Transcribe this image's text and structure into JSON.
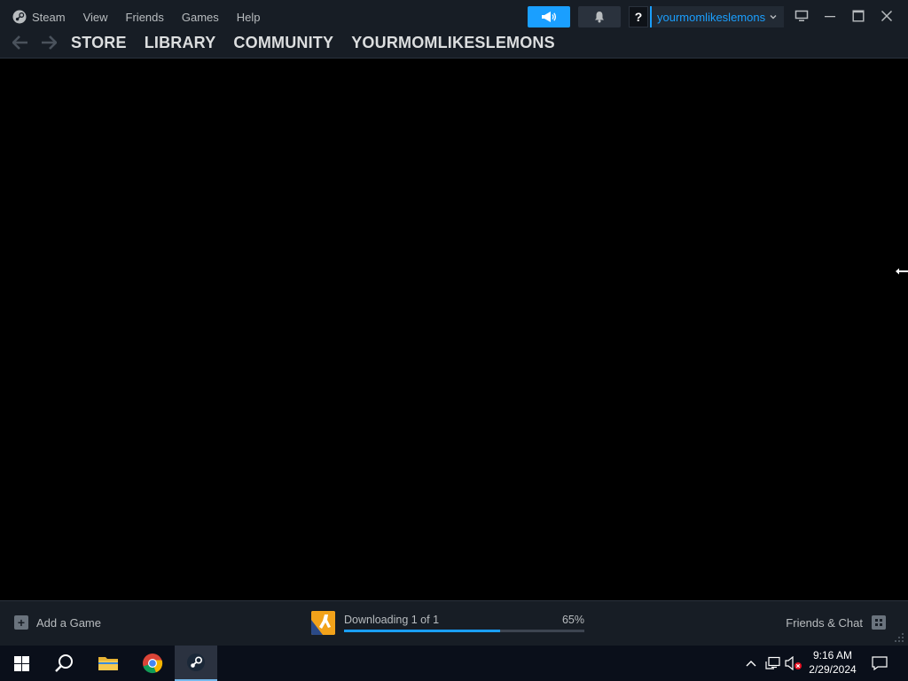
{
  "menu": {
    "steam": "Steam",
    "view": "View",
    "friends": "Friends",
    "games": "Games",
    "help": "Help"
  },
  "nav": {
    "store": "STORE",
    "library": "LIBRARY",
    "community": "COMMUNITY",
    "profile": "YOURMOMLIKESLEMONS"
  },
  "account": {
    "help_label": "?",
    "username": "yourmomlikeslemons"
  },
  "statusbar": {
    "add_game": "Add a Game",
    "download_text": "Downloading 1 of 1",
    "download_percent_label": "65%",
    "download_progress": 0.65,
    "friends_chat": "Friends & Chat"
  },
  "taskbar": {
    "time": "9:16 AM",
    "date": "2/29/2024"
  },
  "colors": {
    "accent": "#1a9fff",
    "titlebar_bg": "#171d25",
    "content_bg": "#000000",
    "taskbar_bg": "#0a0f1a"
  },
  "icons": {
    "steam_logo": "steam-icon",
    "back": "arrow-left-icon",
    "forward": "arrow-right-icon",
    "announcement": "megaphone-icon",
    "notification": "bell-icon",
    "big_picture": "monitor-icon",
    "minimize": "minimize-icon",
    "maximize": "maximize-icon",
    "close": "close-icon",
    "add": "plus-icon",
    "friends": "friends-grid-icon",
    "windows_start": "windows-logo-icon",
    "search": "search-icon",
    "file_explorer": "folder-icon",
    "chrome": "chrome-icon",
    "steam_taskbar": "steam-icon"
  }
}
